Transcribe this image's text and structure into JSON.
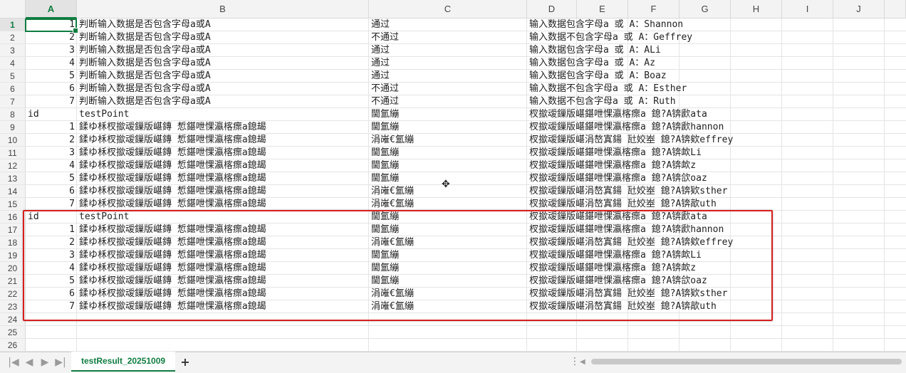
{
  "columns": [
    "A",
    "B",
    "C",
    "D",
    "E",
    "F",
    "G",
    "H",
    "I",
    "J"
  ],
  "rows": [
    {
      "n": "1",
      "a": "1",
      "b": "判断输入数据是否包含字母a或A",
      "c": "通过",
      "d": "输入数据包含字母a 或 A：Shannon"
    },
    {
      "n": "2",
      "a": "2",
      "b": "判断输入数据是否包含字母a或A",
      "c": "不通过",
      "d": "输入数据不包含字母a 或 A：Geffrey"
    },
    {
      "n": "3",
      "a": "3",
      "b": "判断输入数据是否包含字母a或A",
      "c": "通过",
      "d": "输入数据包含字母a 或 A：ALi"
    },
    {
      "n": "4",
      "a": "4",
      "b": "判断输入数据是否包含字母a或A",
      "c": "通过",
      "d": "输入数据包含字母a 或 A：Az"
    },
    {
      "n": "5",
      "a": "5",
      "b": "判断输入数据是否包含字母a或A",
      "c": "通过",
      "d": "输入数据包含字母a 或 A：Boaz"
    },
    {
      "n": "6",
      "a": "6",
      "b": "判断输入数据是否包含字母a或A",
      "c": "不通过",
      "d": "输入数据不包含字母a 或 A：Esther"
    },
    {
      "n": "7",
      "a": "7",
      "b": "判断输入数据是否包含字母a或A",
      "c": "不通过",
      "d": "输入数据不包含字母a 或 A：Ruth"
    },
    {
      "n": "8",
      "a": "id",
      "b": "testPoint",
      "c": "閫氳繃",
      "d": "杈撳叆鏁版嵁鍖呭惈瀛楁瘝a 鎴?A锛歋ata"
    },
    {
      "n": "9",
      "a": "1",
      "b": "鍒ゆ柇杈撳叆鏁版嵁鏄  惁鍖呭惈瀛楁瘝a鎴朅",
      "c": "閫氳繃",
      "d": "杈撳叆鏁版嵁鍖呭惈瀛楁瘝a 鎴?A锛歋hannon"
    },
    {
      "n": "10",
      "a": "2",
      "b": "鍒ゆ柇杈撳叆鏁版嵁鏄  惁鍖呭惈瀛楁瘝a鎴朅",
      "c": "涓嶉€氳繃",
      "d": "杈撳叆鏁版嵁涓嶅寘鍚  瓧姣峚 鎴?A锛欸effrey"
    },
    {
      "n": "11",
      "a": "3",
      "b": "鍒ゆ柇杈撳叆鏁版嵁鏄  惁鍖呭惈瀛楁瘝a鎴朅",
      "c": "閫氳繃",
      "d": "杈撳叆鏁版嵁鍖呭惈瀛楁瘝a 鎴?A锛欰Li"
    },
    {
      "n": "12",
      "a": "4",
      "b": "鍒ゆ柇杈撳叆鏁版嵁鏄  惁鍖呭惈瀛楁瘝a鎴朅",
      "c": "閫氳繃",
      "d": "杈撳叆鏁版嵁鍖呭惈瀛楁瘝a 鎴?A锛欰z"
    },
    {
      "n": "13",
      "a": "5",
      "b": "鍒ゆ柇杈撳叆鏁版嵁鏄  惁鍖呭惈瀛楁瘝a鎴朅",
      "c": "閫氳繃",
      "d": "杈撳叆鏁版嵁鍖呭惈瀛楁瘝a 鎴?A锛欱oaz"
    },
    {
      "n": "14",
      "a": "6",
      "b": "鍒ゆ柇杈撳叆鏁版嵁鏄  惁鍖呭惈瀛楁瘝a鎴朅",
      "c": "涓嶉€氳繃",
      "d": "杈撳叆鏁版嵁涓嶅寘鍚  瓧姣峚 鎴?A锛欵sther"
    },
    {
      "n": "15",
      "a": "7",
      "b": "鍒ゆ柇杈撳叆鏁版嵁鏄  惁鍖呭惈瀛楁瘝a鎴朅",
      "c": "涓嶉€氳繃",
      "d": "杈撳叆鏁版嵁涓嶅寘鍚  瓧姣峚 鎴?A锛歊uth"
    },
    {
      "n": "16",
      "a": "id",
      "b": "testPoint",
      "c": "閫氳繃",
      "d": "杈撳叆鏁版嵁鍖呭惈瀛楁瘝a 鎴?A锛歋ata"
    },
    {
      "n": "17",
      "a": "1",
      "b": "鍒ゆ柇杈撳叆鏁版嵁鏄  惁鍖呭惈瀛楁瘝a鎴朅",
      "c": "閫氳繃",
      "d": "杈撳叆鏁版嵁鍖呭惈瀛楁瘝a 鎴?A锛歋hannon"
    },
    {
      "n": "18",
      "a": "2",
      "b": "鍒ゆ柇杈撳叆鏁版嵁鏄  惁鍖呭惈瀛楁瘝a鎴朅",
      "c": "涓嶉€氳繃",
      "d": "杈撳叆鏁版嵁涓嶅寘鍚  瓧姣峚 鎴?A锛欸effrey"
    },
    {
      "n": "19",
      "a": "3",
      "b": "鍒ゆ柇杈撳叆鏁版嵁鏄  惁鍖呭惈瀛楁瘝a鎴朅",
      "c": "閫氳繃",
      "d": "杈撳叆鏁版嵁鍖呭惈瀛楁瘝a 鎴?A锛欰Li"
    },
    {
      "n": "20",
      "a": "4",
      "b": "鍒ゆ柇杈撳叆鏁版嵁鏄  惁鍖呭惈瀛楁瘝a鎴朅",
      "c": "閫氳繃",
      "d": "杈撳叆鏁版嵁鍖呭惈瀛楁瘝a 鎴?A锛欰z"
    },
    {
      "n": "21",
      "a": "5",
      "b": "鍒ゆ柇杈撳叆鏁版嵁鏄  惁鍖呭惈瀛楁瘝a鎴朅",
      "c": "閫氳繃",
      "d": "杈撳叆鏁版嵁鍖呭惈瀛楁瘝a 鎴?A锛欱oaz"
    },
    {
      "n": "22",
      "a": "6",
      "b": "鍒ゆ柇杈撳叆鏁版嵁鏄  惁鍖呭惈瀛楁瘝a鎴朅",
      "c": "涓嶉€氳繃",
      "d": "杈撳叆鏁版嵁涓嶅寘鍚  瓧姣峚 鎴?A锛欵sther"
    },
    {
      "n": "23",
      "a": "7",
      "b": "鍒ゆ柇杈撳叆鏁版嵁鏄  惁鍖呭惈瀛楁瘝a鎴朅",
      "c": "涓嶉€氳繃",
      "d": "杈撳叆鏁版嵁涓嶅寘鍚  瓧姣峚 鎴?A锛歊uth"
    },
    {
      "n": "24",
      "a": "",
      "b": "",
      "c": "",
      "d": ""
    },
    {
      "n": "25",
      "a": "",
      "b": "",
      "c": "",
      "d": ""
    },
    {
      "n": "26",
      "a": "",
      "b": "",
      "c": "",
      "d": ""
    }
  ],
  "sheet_tab": {
    "label": "testResult_20251009"
  },
  "nav": {
    "first": "|◀",
    "prev": "◀",
    "next": "▶",
    "last": "▶|",
    "add": "+",
    "dots": "⋮"
  },
  "icons": {
    "cursor": "move-cursor-icon"
  },
  "colors": {
    "accent": "#107c41",
    "highlight": "#d61f1f"
  }
}
